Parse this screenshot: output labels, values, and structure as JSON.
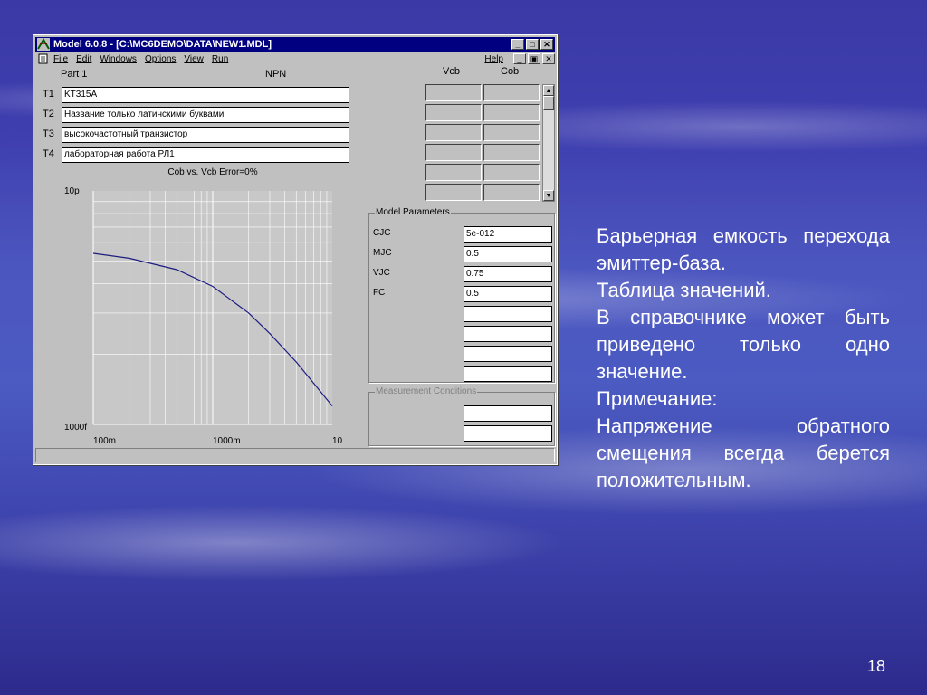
{
  "window": {
    "title": "Model 6.0.8 - [C:\\MC6DEMO\\DATA\\NEW1.MDL]",
    "menus": [
      "File",
      "Edit",
      "Windows",
      "Options",
      "View",
      "Run"
    ],
    "help": "Help"
  },
  "header": {
    "part": "Part 1",
    "type": "NPN",
    "col1": "Vcb",
    "col2": "Cob"
  },
  "text_fields": [
    {
      "label": "T1",
      "value": "KT315A"
    },
    {
      "label": "T2",
      "value": "Название только латинскими буквами"
    },
    {
      "label": "T3",
      "value": "высокочастотный транзистор"
    },
    {
      "label": "T4",
      "value": "лабораторная работа РЛ1"
    }
  ],
  "chart_data": {
    "type": "line",
    "title": "Cob vs. Vcb Error=0%",
    "x_scale": "log",
    "y_scale": "log",
    "xlim": [
      0.1,
      10
    ],
    "ylim": [
      1e-12,
      1e-11
    ],
    "x_tick_labels": [
      "100m",
      "1000m",
      "10"
    ],
    "y_tick_labels": [
      "10p",
      "1000f"
    ],
    "grid": true,
    "series": [
      {
        "x": [
          0.1,
          0.2,
          0.5,
          1,
          2,
          3,
          5,
          7,
          10
        ],
        "y": [
          5.4e-12,
          5.15e-12,
          4.6e-12,
          3.9e-12,
          3e-12,
          2.45e-12,
          1.85e-12,
          1.5e-12,
          1.2e-12
        ]
      }
    ],
    "line_color": "#1c1c80"
  },
  "model_parameters": {
    "title": "Model Parameters",
    "rows": [
      {
        "name": "CJC",
        "value": "5e-012"
      },
      {
        "name": "MJC",
        "value": "0.5"
      },
      {
        "name": "VJC",
        "value": "0.75"
      },
      {
        "name": "FC",
        "value": "0.5"
      }
    ]
  },
  "measurement_conditions": {
    "title": "Measurement Conditions"
  },
  "slide": {
    "paragraphs": [
      "Барьерная емкость перехода эмиттер-база.",
      "Таблица значений.",
      "В справочнике может быть приведено только одно значение.",
      "Примечание:",
      "Напряжение обратного смещения всегда берется положительным."
    ],
    "page_number": "18"
  },
  "colors": {
    "title_bar": "#000080",
    "window": "#c0c0c0",
    "plot_bg": "#c8c8c8",
    "slide_text": "#ffffff"
  }
}
